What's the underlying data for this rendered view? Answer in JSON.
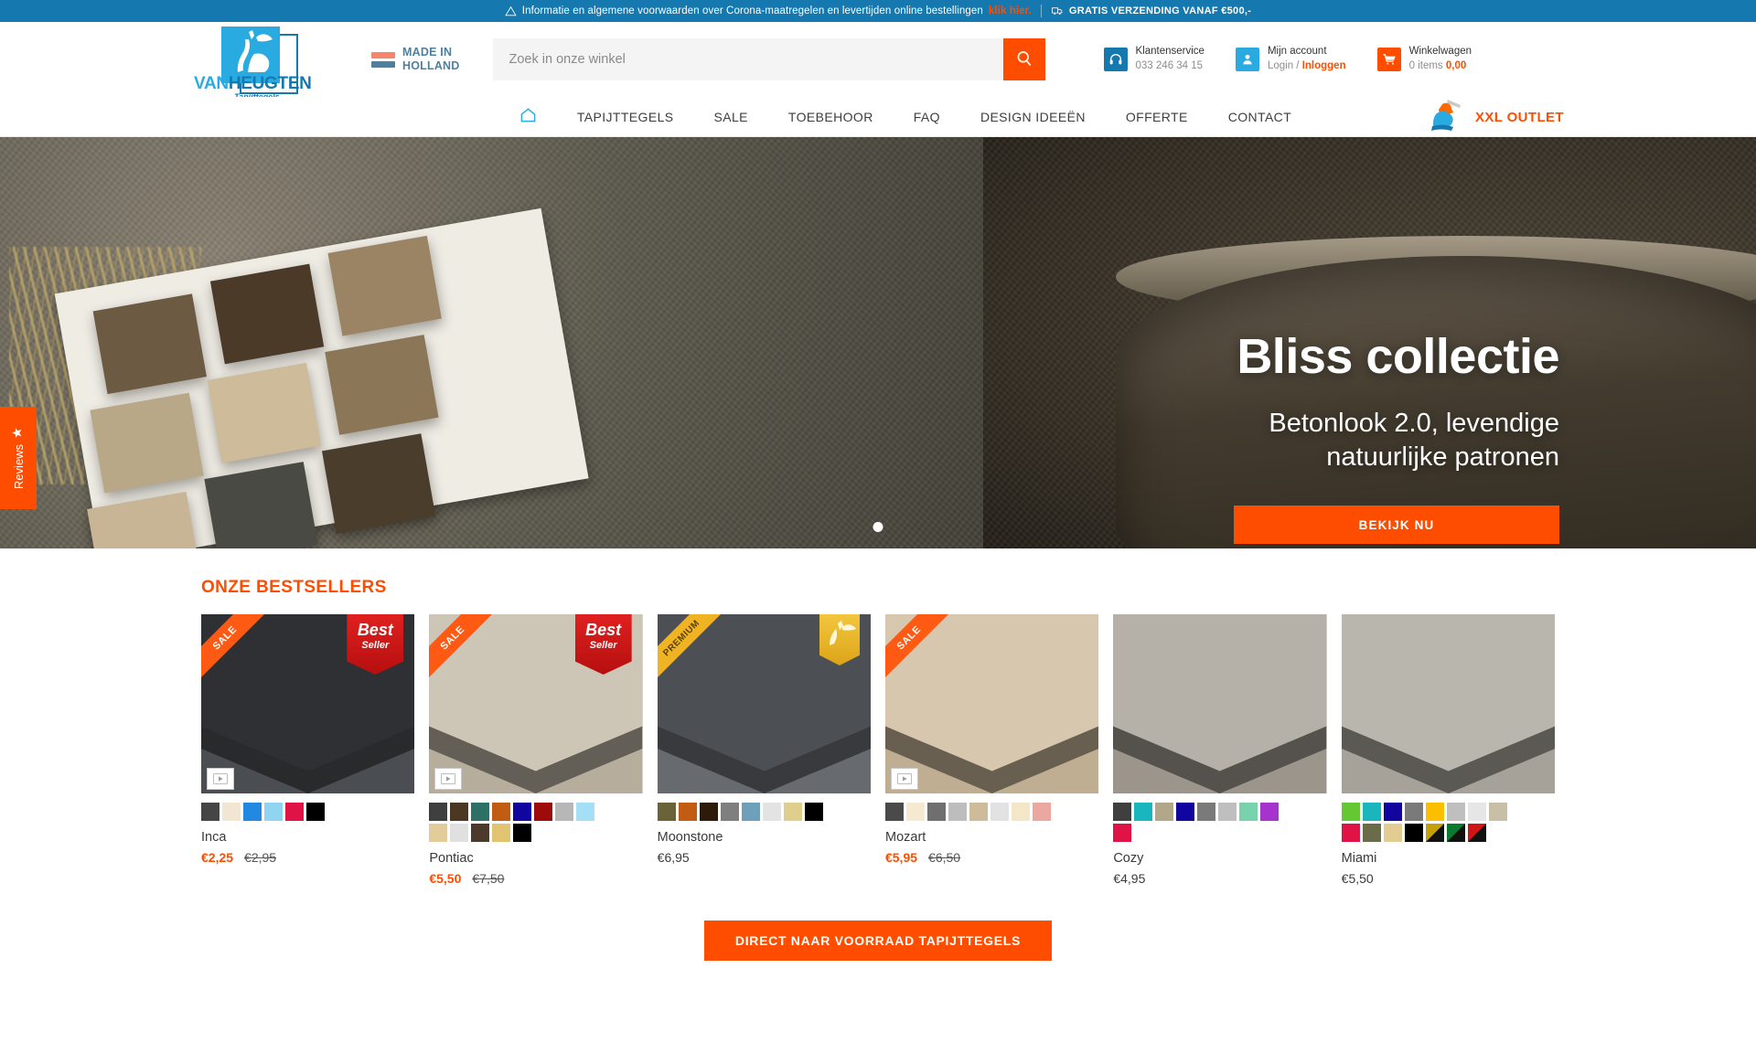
{
  "topbar": {
    "warning_icon": "warning-triangle-icon",
    "notice": "Informatie en algemene voorwaarden over Corona-maatregelen en levertijden online bestellingen",
    "link": "klik hier.",
    "truck_icon": "truck-icon",
    "shipping": "GRATIS VERZENDING VANAF €500,-"
  },
  "header": {
    "logo": {
      "word1": "VAN",
      "word2": "HEUGTEN",
      "sub": "Tapijttegels"
    },
    "made_in": {
      "line1": "MADE IN",
      "line2": "HOLLAND"
    },
    "search": {
      "placeholder": "Zoek in onze winkel",
      "value": "",
      "icon": "search-icon"
    },
    "service": {
      "icon": "headset-icon",
      "label": "Klantenservice",
      "phone": "033 246 34 15"
    },
    "account": {
      "icon": "user-icon",
      "label": "Mijn account",
      "sub": "Login /",
      "action": "Inloggen"
    },
    "cart": {
      "icon": "cart-icon",
      "label": "Winkelwagen",
      "items": "0 items",
      "total": "0,00"
    }
  },
  "nav": {
    "home_icon": "home-icon",
    "items": [
      {
        "label": "TAPIJTTEGELS"
      },
      {
        "label": "SALE"
      },
      {
        "label": "TOEBEHOOR"
      },
      {
        "label": "FAQ"
      },
      {
        "label": "DESIGN IDEEËN"
      },
      {
        "label": "OFFERTE"
      },
      {
        "label": "CONTACT"
      }
    ],
    "outlet": {
      "icon": "knight-mascot-icon",
      "label": "XXL OUTLET"
    }
  },
  "hero": {
    "title": "Bliss collectie",
    "subtitle_line1": "Betonlook 2.0, levendige",
    "subtitle_line2": "natuurlijke patronen",
    "button": "BEKIJK NU",
    "slides": 1
  },
  "reviews_tab": {
    "label": "Reviews",
    "icon": "star-icon"
  },
  "bestsellers": {
    "title": "ONZE BESTSELLERS",
    "cta": "DIRECT NAAR VOORRAAD TAPIJTTEGELS",
    "products": [
      {
        "name": "Inca",
        "price": "€2,25",
        "old_price": "€2,95",
        "on_sale": true,
        "ribbon": "SALE",
        "badge": "best-seller",
        "badge_line1": "Best",
        "badge_line2": "Seller",
        "has_video": true,
        "tile_color": "#2e3033",
        "tile_color2": "#4a4d51",
        "swatches": [
          "#454545",
          "#f2e6d3",
          "#2389e0",
          "#8fd4f0",
          "#e01346",
          "#000000"
        ]
      },
      {
        "name": "Pontiac",
        "price": "€5,50",
        "old_price": "€7,50",
        "on_sale": true,
        "ribbon": "SALE",
        "badge": "best-seller",
        "badge_line1": "Best",
        "badge_line2": "Seller",
        "has_video": true,
        "tile_color": "#cdc5b6",
        "tile_color2": "#b6ad9d",
        "swatches": [
          "#3f3f3f",
          "#4b3722",
          "#2e6f68",
          "#c15c12",
          "#10069f",
          "#9e0b0b",
          "#b7b7b7",
          "#a5dff5",
          "#e3cc9c",
          "#e0e0e0",
          "#4b3a2c",
          "#e0c471",
          "#000000"
        ]
      },
      {
        "name": "Moonstone",
        "price": "€6,95",
        "old_price": "",
        "on_sale": false,
        "ribbon": "PREMIUM",
        "badge": "gold-premium",
        "badge_line1": "",
        "badge_line2": "",
        "has_video": false,
        "tile_color": "#4c5055",
        "tile_color2": "#676b70",
        "swatches": [
          "#6a6238",
          "#c15c12",
          "#2d1a08",
          "#7f7f7f",
          "#6fa0bb",
          "#e3e3e3",
          "#e0cf8c",
          "#000000"
        ]
      },
      {
        "name": "Mozart",
        "price": "€5,95",
        "old_price": "€6,50",
        "on_sale": true,
        "ribbon": "SALE",
        "badge": "",
        "badge_line1": "",
        "badge_line2": "",
        "has_video": true,
        "tile_color": "#d6c7ae",
        "tile_color2": "#bfae92",
        "swatches": [
          "#4a4a4a",
          "#f6e9d2",
          "#6f6f6f",
          "#bdbdbd",
          "#cdbb9a",
          "#e2e2e2",
          "#f4e7c8",
          "#eba8a0"
        ]
      },
      {
        "name": "Cozy",
        "price": "€4,95",
        "old_price": "",
        "on_sale": false,
        "ribbon": "",
        "badge": "",
        "badge_line1": "",
        "badge_line2": "",
        "has_video": false,
        "tile_color": "#b5b0a8",
        "tile_color2": "#9b958c",
        "swatches": [
          "#3f3f3f",
          "#19b6bd",
          "#b3a78b",
          "#10069f",
          "#7a7a7a",
          "#bfbfbf",
          "#77d2ad",
          "#a533cc",
          "#e01346"
        ]
      },
      {
        "name": "Miami",
        "price": "€5,50",
        "old_price": "",
        "on_sale": false,
        "ribbon": "",
        "badge": "",
        "badge_line1": "",
        "badge_line2": "",
        "has_video": false,
        "tile_color": "#b9b6ad",
        "tile_color2": "#a6a299",
        "swatches": [
          "#63c832",
          "#19b6bd",
          "#10069f",
          "#7a7a7a",
          "#fbbf00",
          "#bfbfbf",
          "#e6e6e6",
          "#c8bfa6",
          "#e01346",
          "#6a6b48",
          "#e3cc92",
          "#000000",
          "#c6a00a",
          "#0a7a2e",
          "#cf1515"
        ]
      }
    ]
  },
  "colors": {
    "brand_blue": "#1579b0",
    "brand_light_blue": "#29abe2",
    "accent_orange": "#ff4d00"
  }
}
